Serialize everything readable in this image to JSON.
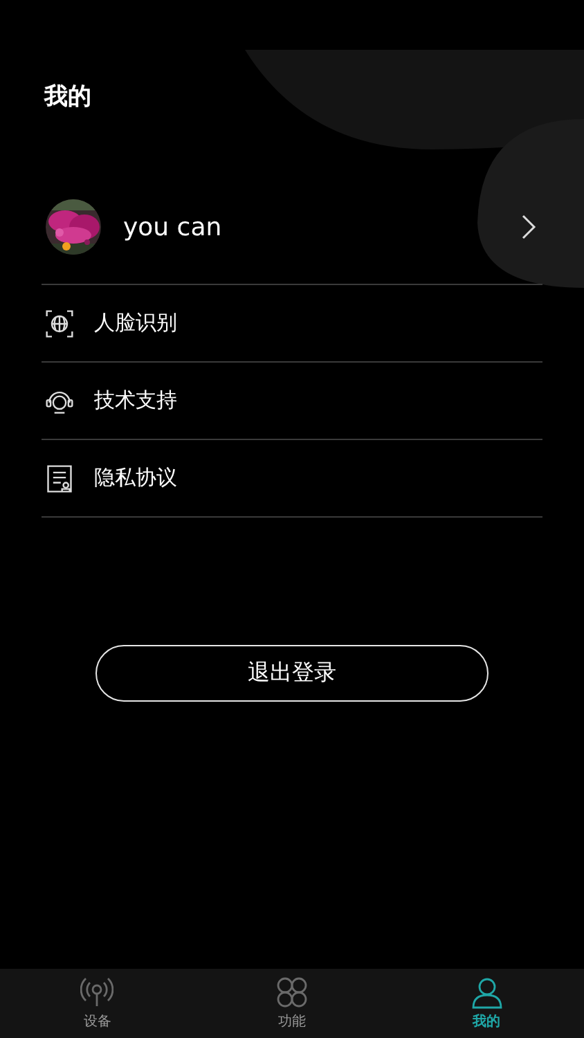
{
  "header": {
    "title": "我的"
  },
  "profile": {
    "name": "you can"
  },
  "menu": [
    {
      "kind": "face",
      "label": "人脸识别"
    },
    {
      "kind": "support",
      "label": "技术支持"
    },
    {
      "kind": "document",
      "label": "隐私协议"
    }
  ],
  "logout": {
    "label": "退出登录"
  },
  "tabs": [
    {
      "kind": "signal",
      "label": "设备",
      "selected": false
    },
    {
      "kind": "grid",
      "label": "功能",
      "selected": false
    },
    {
      "kind": "person",
      "label": "我的",
      "selected": true
    }
  ]
}
